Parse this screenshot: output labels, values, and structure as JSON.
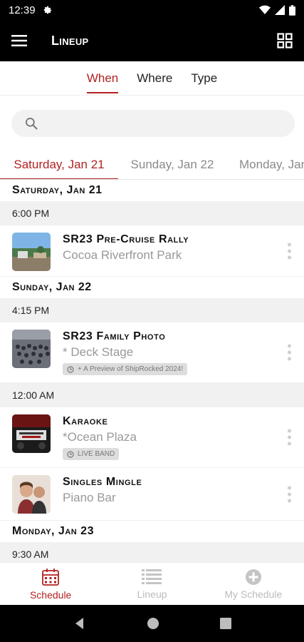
{
  "status_bar": {
    "time": "12:39"
  },
  "app_bar": {
    "title": "Lineup"
  },
  "seg_tabs": [
    {
      "label": "When",
      "active": true
    },
    {
      "label": "Where",
      "active": false
    },
    {
      "label": "Type",
      "active": false
    }
  ],
  "search": {
    "placeholder": "",
    "value": ""
  },
  "date_tabs": [
    {
      "label": "Saturday, Jan 21",
      "active": true
    },
    {
      "label": "Sunday, Jan 22",
      "active": false
    },
    {
      "label": "Monday, Jan 23",
      "active": false
    }
  ],
  "schedule": {
    "days": [
      {
        "label": "Saturday, Jan 21",
        "slots": [
          {
            "time": "6:00 PM",
            "events": [
              {
                "title": "SR23 Pre-Cruise Rally",
                "location": "Cocoa Riverfront Park",
                "tag": ""
              }
            ]
          }
        ]
      },
      {
        "label": "Sunday, Jan 22",
        "slots": [
          {
            "time": "4:15 PM",
            "events": [
              {
                "title": "SR23 Family Photo",
                "location": "* Deck Stage",
                "tag": "+ A Preview of ShipRocked 2024!"
              }
            ]
          },
          {
            "time": "12:00 AM",
            "events": [
              {
                "title": "Karaoke",
                "location": "*Ocean Plaza",
                "tag": "LIVE BAND"
              },
              {
                "title": "Singles Mingle",
                "location": "Piano Bar",
                "tag": ""
              }
            ]
          }
        ]
      },
      {
        "label": "Monday, Jan 23",
        "slots": [
          {
            "time": "9:30 AM",
            "events": []
          }
        ]
      }
    ]
  },
  "bottom_nav": [
    {
      "label": "Schedule",
      "icon": "calendar-icon",
      "active": true
    },
    {
      "label": "Lineup",
      "icon": "list-icon",
      "active": false
    },
    {
      "label": "My Schedule",
      "icon": "add-circle-icon",
      "active": false
    }
  ],
  "colors": {
    "accent": "#b22222",
    "app_bar": "#000000",
    "muted": "#999999"
  }
}
